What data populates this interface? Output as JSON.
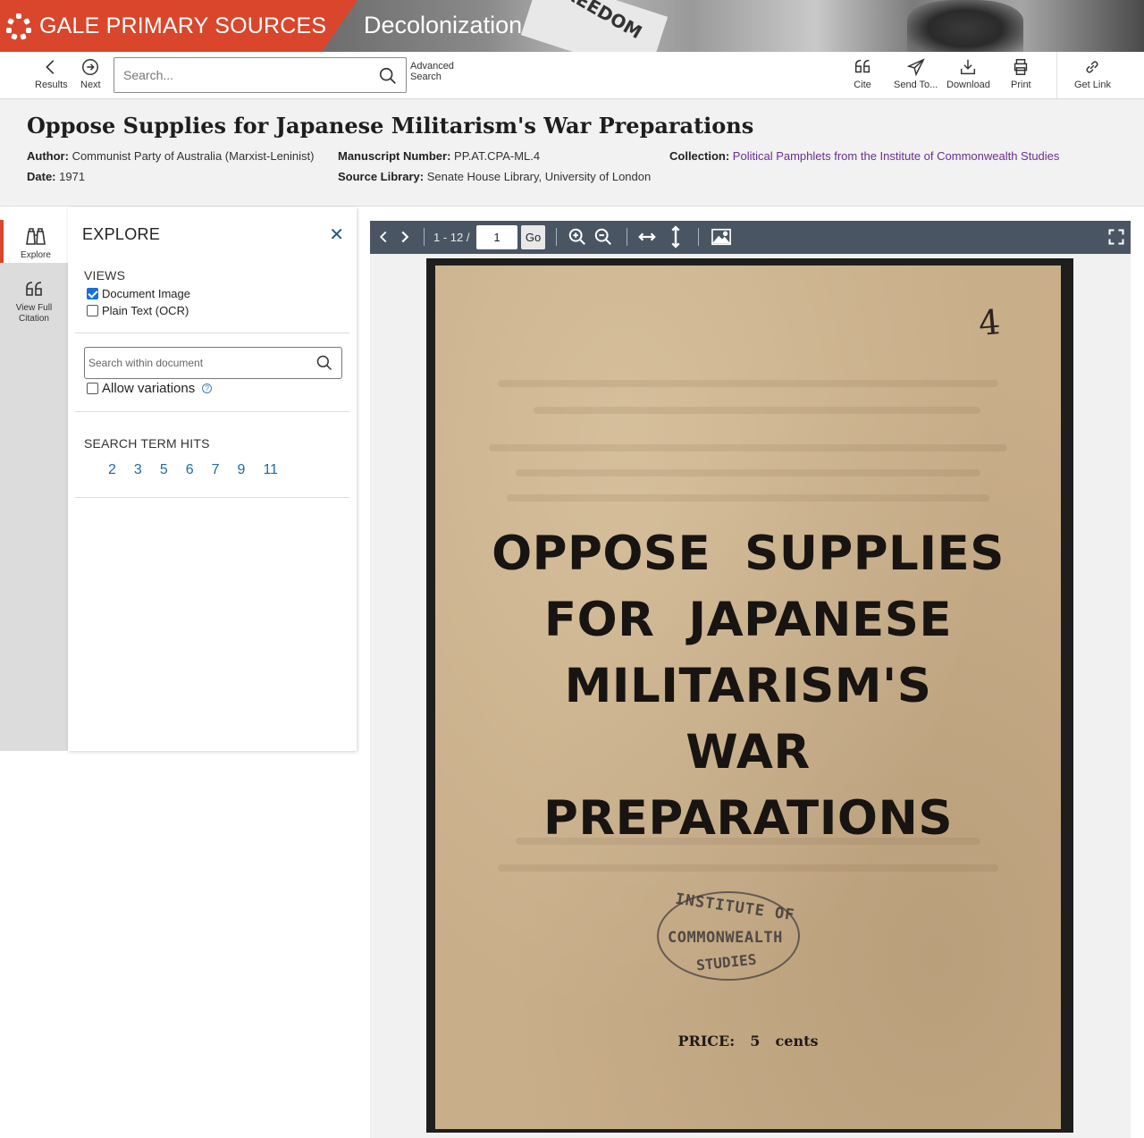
{
  "banner": {
    "brand": "GALE PRIMARY SOURCES",
    "collection": "Decolonization",
    "sign_text": "FREEDOM",
    "brand_color": "#d9462b"
  },
  "toolbar": {
    "results_label": "Results",
    "next_label": "Next",
    "search_placeholder": "Search...",
    "advanced_line1": "Advanced",
    "advanced_line2": "Search",
    "cite_label": "Cite",
    "send_label": "Send To...",
    "download_label": "Download",
    "print_label": "Print",
    "getlink_label": "Get Link"
  },
  "document": {
    "title": "Oppose Supplies for Japanese Militarism's War Preparations",
    "author_label": "Author:",
    "author": "Communist Party of Australia (Marxist-Leninist)",
    "date_label": "Date:",
    "date": "1971",
    "manuscript_label": "Manuscript Number:",
    "manuscript": "PP.AT.CPA-ML.4",
    "source_label": "Source Library:",
    "source": "Senate House Library, University of London",
    "collection_label": "Collection:",
    "collection": "Political Pamphlets from the Institute of Commonwealth Studies"
  },
  "rail": {
    "explore_label": "Explore",
    "citation_line1": "View Full",
    "citation_line2": "Citation"
  },
  "explore": {
    "heading": "EXPLORE",
    "views_label": "VIEWS",
    "views": [
      {
        "label": "Document Image",
        "checked": true
      },
      {
        "label": "Plain Text (OCR)",
        "checked": false
      }
    ],
    "search_placeholder": "Search within document",
    "allow_variations": "Allow variations",
    "hits_label": "SEARCH TERM HITS",
    "hits": [
      "2",
      "3",
      "5",
      "6",
      "7",
      "9",
      "11"
    ]
  },
  "viewer": {
    "page_range": "1 - 12 /",
    "page_value": "1",
    "go_label": "Go",
    "bar_color": "#4a5563"
  },
  "page_image": {
    "handwritten_number": "4",
    "title_lines": [
      "OPPOSE  SUPPLIES",
      "FOR  JAPANESE",
      "MILITARISM'S",
      "WAR",
      "PREPARATIONS"
    ],
    "stamp_line1": "INSTITUTE OF",
    "stamp_line2": "COMMONWEALTH",
    "stamp_line3": "STUDIES",
    "price": "PRICE:  5  cents"
  }
}
